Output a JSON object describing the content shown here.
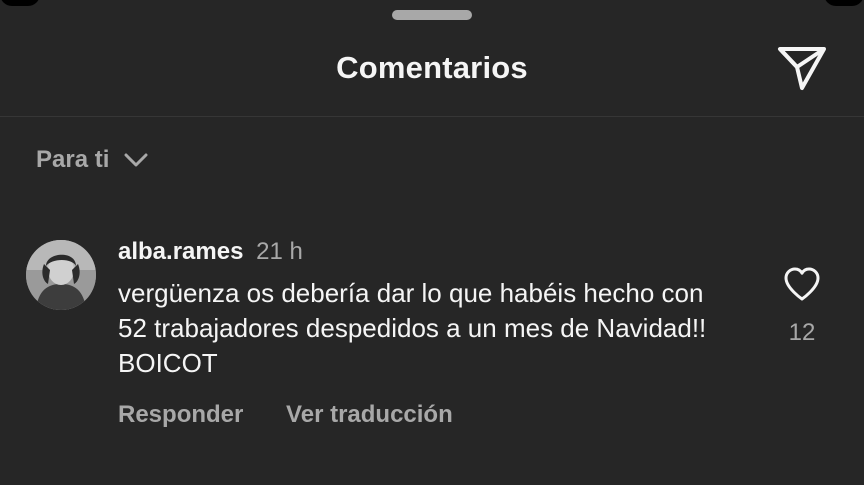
{
  "header": {
    "title": "Comentarios",
    "share_icon": "paper-plane-icon"
  },
  "filter": {
    "label": "Para ti",
    "icon": "chevron-down-icon"
  },
  "comments": [
    {
      "username": "alba.rames",
      "time": "21 h",
      "text": "vergüenza os debería dar lo que habéis hecho con 52 trabajadores despedidos a un mes de Navidad!! BOICOT",
      "reply_label": "Responder",
      "translate_label": "Ver traducción",
      "like_icon": "heart-outline-icon",
      "like_count": "12"
    }
  ],
  "colors": {
    "background": "#262626",
    "primary_text": "#f5f5f5",
    "secondary_text": "#a8a8a8",
    "divider": "#363636"
  }
}
